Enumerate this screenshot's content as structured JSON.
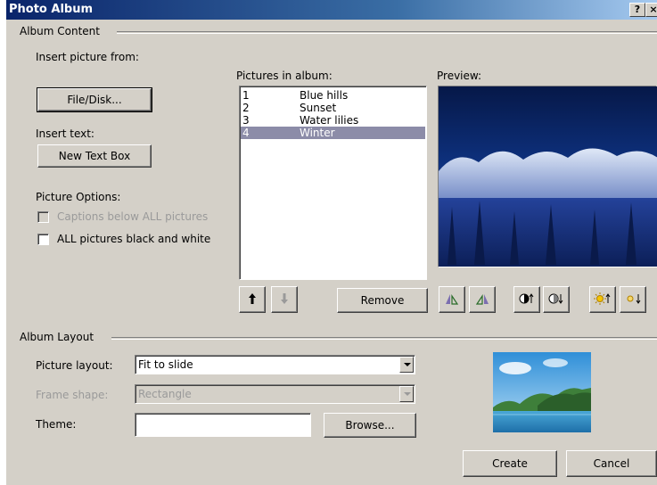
{
  "window": {
    "title": "Photo Album",
    "help_button": "?",
    "close_button": "×"
  },
  "album_content": {
    "group_label": "Album Content",
    "insert_picture_label": "Insert picture from:",
    "file_disk_button": "File/Disk...",
    "insert_text_label": "Insert text:",
    "new_text_box_button": "New Text Box",
    "picture_options_label": "Picture Options:",
    "captions_checkbox": {
      "label": "Captions below ALL pictures",
      "checked": false,
      "enabled": false
    },
    "black_white_checkbox": {
      "label": "ALL pictures black and white",
      "checked": false,
      "enabled": true
    },
    "pictures_in_album_label": "Pictures in album:",
    "pictures": [
      {
        "num": "1",
        "name": "Blue hills",
        "selected": false
      },
      {
        "num": "2",
        "name": "Sunset",
        "selected": false
      },
      {
        "num": "3",
        "name": "Water lilies",
        "selected": false
      },
      {
        "num": "4",
        "name": "Winter",
        "selected": true
      }
    ],
    "move_up_icon": "arrow-up-icon",
    "move_down_icon": "arrow-down-icon",
    "remove_button": "Remove",
    "preview_label": "Preview:",
    "preview_image": "winter-forest"
  },
  "album_layout": {
    "group_label": "Album Layout",
    "picture_layout_label": "Picture layout:",
    "picture_layout_value": "Fit to slide",
    "frame_shape_label": "Frame shape:",
    "frame_shape_value": "Rectangle",
    "theme_label": "Theme:",
    "theme_value": "",
    "browse_button": "Browse...",
    "layout_preview_image": "landscape-thumbnail"
  },
  "footer": {
    "create_button": "Create",
    "cancel_button": "Cancel"
  },
  "colors": {
    "titlebar": "#0a246a",
    "dialog_bg": "#d4d0c8",
    "selection": "#8c8ca8"
  }
}
